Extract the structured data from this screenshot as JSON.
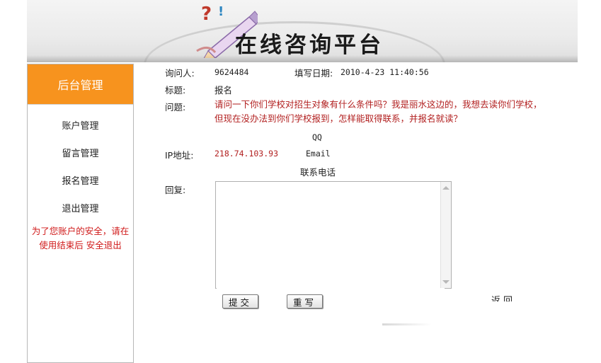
{
  "banner": {
    "title": "在线咨询平台"
  },
  "sidebar": {
    "header": "后台管理",
    "items": [
      {
        "label": "账户管理"
      },
      {
        "label": "留言管理"
      },
      {
        "label": "报名管理"
      },
      {
        "label": "退出管理"
      }
    ],
    "notice_text": "为了您账户的安全，请在使用结束后",
    "notice_link": "安全退出"
  },
  "detail": {
    "inquirer_label": "询问人:",
    "inquirer_value": "9624484",
    "date_label": "填写日期:",
    "date_value": "2010-4-23 11:40:56",
    "subject_label": "标题:",
    "subject_value": "报名",
    "question_label": "问题:",
    "question_value": "请问一下你们学校对招生对象有什么条件吗？我是丽水这边的，我想去读你们学校，但现在没办法到你们学校报到，怎样能取得联系，并报名就读？",
    "qq_label": "QQ",
    "ip_label": "IP地址:",
    "ip_value": "218.74.103.93",
    "email_label": "Email",
    "phone_label": "联系电话",
    "reply_label": "回复:",
    "reply_value": ""
  },
  "actions": {
    "submit_label": "提交",
    "reset_label": "重写",
    "back_label": "返回"
  },
  "colors": {
    "accent": "#f7931e",
    "alert_red": "#b22020"
  }
}
